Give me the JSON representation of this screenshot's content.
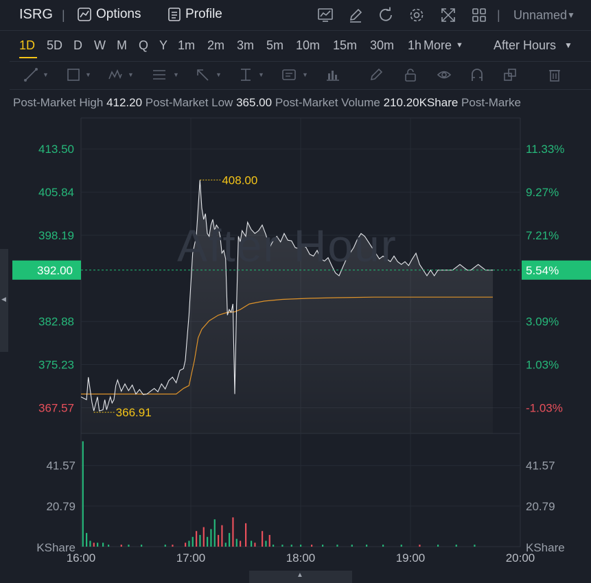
{
  "header": {
    "ticker": "ISRG",
    "options_label": "Options",
    "profile_label": "Profile",
    "layout_name": "Unnamed"
  },
  "intervals": {
    "items": [
      "1D",
      "5D",
      "D",
      "W",
      "M",
      "Q",
      "Y",
      "1m",
      "2m",
      "3m",
      "5m",
      "10m",
      "15m",
      "30m",
      "1h"
    ],
    "more_label": "More",
    "active": "1D",
    "session": "After Hours"
  },
  "stats": {
    "high_label": "Post-Market High",
    "high_value": "412.20",
    "low_label": "Post-Market Low",
    "low_value": "365.00",
    "volume_label": "Post-Market Volume",
    "volume_value": "210.20KShare",
    "truncated_label": "Post-Marke"
  },
  "watermark": "After Hour",
  "colors": {
    "up": "#26b87a",
    "down": "#e8505b",
    "accent": "#f5c518",
    "avg_line": "#e0942a",
    "price_line": "#e6e8ec",
    "current_tag": "#1fbf75"
  },
  "chart_data": {
    "type": "line",
    "y_ticks_left": [
      "413.50",
      "405.84",
      "398.19",
      "382.88",
      "375.23",
      "367.57"
    ],
    "y_ticks_right": [
      "11.33%",
      "9.27%",
      "7.21%",
      "3.09%",
      "1.03%",
      "-1.03%"
    ],
    "y_tick_values": [
      413.5,
      405.84,
      398.19,
      382.88,
      375.23,
      367.57
    ],
    "current_price": "392.00",
    "current_pct": "5.54%",
    "high_marker": "408.00",
    "low_marker": "366.91",
    "x_ticks": [
      "16:00",
      "17:00",
      "18:00",
      "19:00",
      "20:00"
    ],
    "ylim": [
      363.0,
      419.0
    ],
    "xlim_minutes": [
      0,
      240
    ],
    "price_series": [
      {
        "t": 0,
        "p": 369.5
      },
      {
        "t": 3,
        "p": 369.0
      },
      {
        "t": 4,
        "p": 373.0
      },
      {
        "t": 6,
        "p": 368.5
      },
      {
        "t": 7,
        "p": 367.0
      },
      {
        "t": 9,
        "p": 369.5
      },
      {
        "t": 10,
        "p": 367.0
      },
      {
        "t": 12,
        "p": 367.2
      },
      {
        "t": 13,
        "p": 369.0
      },
      {
        "t": 14,
        "p": 367.2
      },
      {
        "t": 16,
        "p": 369.5
      },
      {
        "t": 17,
        "p": 368.4
      },
      {
        "t": 18,
        "p": 369.0
      },
      {
        "t": 19,
        "p": 371.5
      },
      {
        "t": 20,
        "p": 372.5
      },
      {
        "t": 22,
        "p": 370.5
      },
      {
        "t": 24,
        "p": 371.8
      },
      {
        "t": 26,
        "p": 370.6
      },
      {
        "t": 28,
        "p": 371.6
      },
      {
        "t": 30,
        "p": 370.0
      },
      {
        "t": 32,
        "p": 370.8
      },
      {
        "t": 34,
        "p": 369.9
      },
      {
        "t": 36,
        "p": 370.0
      },
      {
        "t": 38,
        "p": 370.5
      },
      {
        "t": 40,
        "p": 371.0
      },
      {
        "t": 42,
        "p": 370.4
      },
      {
        "t": 44,
        "p": 371.8
      },
      {
        "t": 46,
        "p": 370.9
      },
      {
        "t": 48,
        "p": 372.4
      },
      {
        "t": 50,
        "p": 373.0
      },
      {
        "t": 52,
        "p": 372.0
      },
      {
        "t": 54,
        "p": 374.2
      },
      {
        "t": 56,
        "p": 374.5
      },
      {
        "t": 57,
        "p": 376.0
      },
      {
        "t": 59,
        "p": 384.0
      },
      {
        "t": 61,
        "p": 395.0
      },
      {
        "t": 63,
        "p": 398.0
      },
      {
        "t": 65,
        "p": 408.0
      },
      {
        "t": 66,
        "p": 403.0
      },
      {
        "t": 67,
        "p": 401.0
      },
      {
        "t": 68,
        "p": 402.0
      },
      {
        "t": 69,
        "p": 398.5
      },
      {
        "t": 70,
        "p": 398.0
      },
      {
        "t": 71,
        "p": 400.0
      },
      {
        "t": 72,
        "p": 401.0
      },
      {
        "t": 73,
        "p": 399.0
      },
      {
        "t": 74,
        "p": 400.0
      },
      {
        "t": 75,
        "p": 399.5
      },
      {
        "t": 76,
        "p": 398.0
      },
      {
        "t": 77,
        "p": 395.0
      },
      {
        "t": 78,
        "p": 395.5
      },
      {
        "t": 79,
        "p": 394.0
      },
      {
        "t": 80,
        "p": 384.0
      },
      {
        "t": 81,
        "p": 385.0
      },
      {
        "t": 82,
        "p": 384.5
      },
      {
        "t": 83,
        "p": 386.0
      },
      {
        "t": 84,
        "p": 370.0
      },
      {
        "t": 85,
        "p": 386.0
      },
      {
        "t": 86,
        "p": 398.0
      },
      {
        "t": 87,
        "p": 397.0
      },
      {
        "t": 88,
        "p": 399.0
      },
      {
        "t": 90,
        "p": 398.0
      },
      {
        "t": 91,
        "p": 400.5
      },
      {
        "t": 93,
        "p": 399.2
      },
      {
        "t": 95,
        "p": 398.5
      },
      {
        "t": 97,
        "p": 399.0
      },
      {
        "t": 99,
        "p": 400.0
      },
      {
        "t": 101,
        "p": 398.3
      },
      {
        "t": 103,
        "p": 396.0
      },
      {
        "t": 105,
        "p": 397.2
      },
      {
        "t": 107,
        "p": 398.0
      },
      {
        "t": 109,
        "p": 397.0
      },
      {
        "t": 111,
        "p": 398.5
      },
      {
        "t": 113,
        "p": 397.3
      },
      {
        "t": 115,
        "p": 397.2
      },
      {
        "t": 117,
        "p": 396.0
      },
      {
        "t": 119,
        "p": 395.8
      },
      {
        "t": 121,
        "p": 396.5
      },
      {
        "t": 123,
        "p": 396.0
      },
      {
        "t": 125,
        "p": 394.8
      },
      {
        "t": 127,
        "p": 394.5
      },
      {
        "t": 129,
        "p": 395.5
      },
      {
        "t": 131,
        "p": 394.0
      },
      {
        "t": 133,
        "p": 393.6
      },
      {
        "t": 135,
        "p": 394.2
      },
      {
        "t": 137,
        "p": 392.8
      },
      {
        "t": 139,
        "p": 391.5
      },
      {
        "t": 141,
        "p": 391.0
      },
      {
        "t": 143,
        "p": 392.5
      },
      {
        "t": 145,
        "p": 394.0
      },
      {
        "t": 147,
        "p": 395.0
      },
      {
        "t": 149,
        "p": 396.0
      },
      {
        "t": 151,
        "p": 397.5
      },
      {
        "t": 153,
        "p": 398.5
      },
      {
        "t": 155,
        "p": 398.0
      },
      {
        "t": 157,
        "p": 397.0
      },
      {
        "t": 159,
        "p": 396.0
      },
      {
        "t": 161,
        "p": 395.0
      },
      {
        "t": 163,
        "p": 394.0
      },
      {
        "t": 165,
        "p": 394.5
      },
      {
        "t": 167,
        "p": 394.0
      },
      {
        "t": 169,
        "p": 393.5
      },
      {
        "t": 171,
        "p": 394.5
      },
      {
        "t": 173,
        "p": 393.5
      },
      {
        "t": 175,
        "p": 393.0
      },
      {
        "t": 177,
        "p": 393.5
      },
      {
        "t": 179,
        "p": 392.8
      },
      {
        "t": 181,
        "p": 394.0
      },
      {
        "t": 183,
        "p": 395.0
      },
      {
        "t": 185,
        "p": 393.0
      },
      {
        "t": 187,
        "p": 392.0
      },
      {
        "t": 189,
        "p": 391.0
      },
      {
        "t": 191,
        "p": 392.0
      },
      {
        "t": 193,
        "p": 391.0
      },
      {
        "t": 195,
        "p": 392.0
      },
      {
        "t": 197,
        "p": 392.0
      },
      {
        "t": 199,
        "p": 392.0
      },
      {
        "t": 201,
        "p": 392.0
      },
      {
        "t": 203,
        "p": 392.0
      },
      {
        "t": 205,
        "p": 392.5
      },
      {
        "t": 207,
        "p": 393.0
      },
      {
        "t": 209,
        "p": 392.5
      },
      {
        "t": 211,
        "p": 392.0
      },
      {
        "t": 213,
        "p": 392.0
      },
      {
        "t": 215,
        "p": 392.5
      },
      {
        "t": 217,
        "p": 393.0
      },
      {
        "t": 219,
        "p": 392.5
      },
      {
        "t": 221,
        "p": 392.0
      },
      {
        "t": 225,
        "p": 392.0
      }
    ],
    "avg_series": [
      {
        "t": 0,
        "p": 370.0
      },
      {
        "t": 40,
        "p": 370.0
      },
      {
        "t": 52,
        "p": 370.0
      },
      {
        "t": 56,
        "p": 371.0
      },
      {
        "t": 59,
        "p": 371.5
      },
      {
        "t": 62,
        "p": 376.0
      },
      {
        "t": 64,
        "p": 380.0
      },
      {
        "t": 66,
        "p": 381.5
      },
      {
        "t": 70,
        "p": 383.0
      },
      {
        "t": 75,
        "p": 384.0
      },
      {
        "t": 80,
        "p": 384.5
      },
      {
        "t": 84,
        "p": 384.6
      },
      {
        "t": 87,
        "p": 385.0
      },
      {
        "t": 92,
        "p": 386.0
      },
      {
        "t": 100,
        "p": 386.5
      },
      {
        "t": 110,
        "p": 386.8
      },
      {
        "t": 125,
        "p": 387.0
      },
      {
        "t": 140,
        "p": 387.1
      },
      {
        "t": 160,
        "p": 387.2
      },
      {
        "t": 190,
        "p": 387.2
      },
      {
        "t": 225,
        "p": 387.2
      }
    ],
    "volume_ticks_left": [
      "41.57",
      "20.79"
    ],
    "volume_ticks_right": [
      "41.57",
      "20.79"
    ],
    "volume_tick_values": [
      41.57,
      20.79
    ],
    "volume_unit": "KShare",
    "volume_ylim": [
      0,
      58
    ],
    "volume_bars": [
      {
        "t": 1,
        "v": 54,
        "up": true
      },
      {
        "t": 3,
        "v": 7,
        "up": true
      },
      {
        "t": 5,
        "v": 3,
        "up": true
      },
      {
        "t": 7,
        "v": 2,
        "up": false
      },
      {
        "t": 9,
        "v": 2,
        "up": true
      },
      {
        "t": 12,
        "v": 2,
        "up": true
      },
      {
        "t": 15,
        "v": 1,
        "up": true
      },
      {
        "t": 22,
        "v": 1,
        "up": false
      },
      {
        "t": 26,
        "v": 1,
        "up": true
      },
      {
        "t": 33,
        "v": 1,
        "up": true
      },
      {
        "t": 46,
        "v": 1,
        "up": true
      },
      {
        "t": 50,
        "v": 1,
        "up": false
      },
      {
        "t": 57,
        "v": 2,
        "up": false
      },
      {
        "t": 59,
        "v": 3,
        "up": true
      },
      {
        "t": 61,
        "v": 5,
        "up": true
      },
      {
        "t": 63,
        "v": 8,
        "up": false
      },
      {
        "t": 65,
        "v": 6,
        "up": true
      },
      {
        "t": 67,
        "v": 10,
        "up": false
      },
      {
        "t": 69,
        "v": 5,
        "up": true
      },
      {
        "t": 71,
        "v": 9,
        "up": true
      },
      {
        "t": 73,
        "v": 14,
        "up": true
      },
      {
        "t": 75,
        "v": 6,
        "up": false
      },
      {
        "t": 77,
        "v": 11,
        "up": false
      },
      {
        "t": 79,
        "v": 2,
        "up": true
      },
      {
        "t": 81,
        "v": 7,
        "up": true
      },
      {
        "t": 83,
        "v": 15,
        "up": false
      },
      {
        "t": 85,
        "v": 4,
        "up": true
      },
      {
        "t": 87,
        "v": 3,
        "up": false
      },
      {
        "t": 90,
        "v": 12,
        "up": false
      },
      {
        "t": 93,
        "v": 3,
        "up": true
      },
      {
        "t": 95,
        "v": 2,
        "up": false
      },
      {
        "t": 99,
        "v": 8,
        "up": false
      },
      {
        "t": 101,
        "v": 3,
        "up": true
      },
      {
        "t": 103,
        "v": 6,
        "up": false
      },
      {
        "t": 105,
        "v": 1,
        "up": true
      },
      {
        "t": 110,
        "v": 1,
        "up": true
      },
      {
        "t": 115,
        "v": 1,
        "up": true
      },
      {
        "t": 120,
        "v": 1,
        "up": true
      },
      {
        "t": 126,
        "v": 1,
        "up": false
      },
      {
        "t": 132,
        "v": 1,
        "up": true
      },
      {
        "t": 140,
        "v": 1,
        "up": true
      },
      {
        "t": 148,
        "v": 1,
        "up": true
      },
      {
        "t": 156,
        "v": 1,
        "up": true
      },
      {
        "t": 165,
        "v": 1,
        "up": true
      },
      {
        "t": 175,
        "v": 1,
        "up": true
      },
      {
        "t": 185,
        "v": 1,
        "up": false
      },
      {
        "t": 195,
        "v": 1,
        "up": true
      },
      {
        "t": 205,
        "v": 1,
        "up": true
      },
      {
        "t": 215,
        "v": 1,
        "up": true
      }
    ]
  }
}
